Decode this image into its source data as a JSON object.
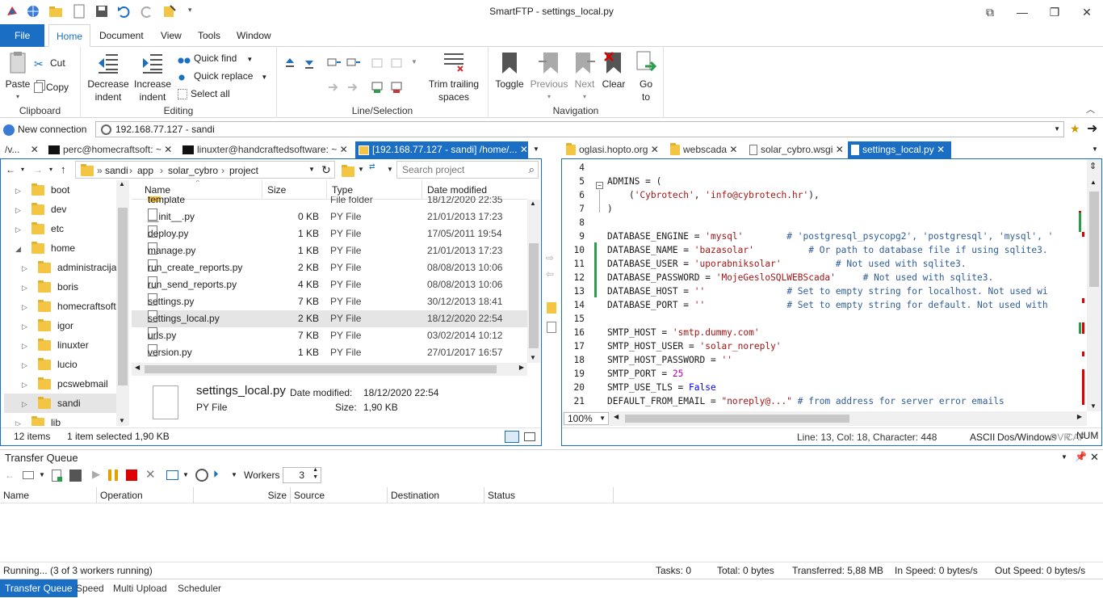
{
  "app": {
    "title": "SmartFTP - settings_local.py"
  },
  "ribbon_tabs": [
    "File",
    "Home",
    "Document",
    "View",
    "Tools",
    "Window"
  ],
  "ribbon": {
    "clipboard": {
      "label": "Clipboard",
      "paste": "Paste",
      "cut": "Cut",
      "copy": "Copy"
    },
    "editing": {
      "label": "Editing",
      "decrease_indent_1": "Decrease",
      "decrease_indent_2": "indent",
      "increase_indent_1": "Increase",
      "increase_indent_2": "indent",
      "quick_find": "Quick find",
      "quick_replace": "Quick replace",
      "select_all": "Select all"
    },
    "line_selection": {
      "label": "Line/Selection",
      "trim_1": "Trim trailing",
      "trim_2": "spaces"
    },
    "navigation": {
      "label": "Navigation",
      "toggle": "Toggle",
      "previous": "Previous",
      "next": "Next",
      "clear": "Clear",
      "goto_1": "Go",
      "goto_2": "to"
    }
  },
  "address": {
    "new_connection": "New connection",
    "value": "192.168.77.127 - sandi"
  },
  "left_tabs": [
    "/v...",
    "perc@homecraftsoft: ~",
    "linuxter@handcraftedsoftware: ~",
    "[192.168.77.127 - sandi] /home/..."
  ],
  "right_tabs": [
    "oglasi.hopto.org",
    "webscada",
    "solar_cybro.wsgi",
    "settings_local.py"
  ],
  "explorer": {
    "breadcrumb": [
      "sandi",
      "app",
      "solar_cybro",
      "project"
    ],
    "search_placeholder": "Search project",
    "tree": [
      "boot",
      "dev",
      "etc",
      "home",
      "administracija",
      "boris",
      "homecraftsoft",
      "igor",
      "linuxter",
      "lucio",
      "pcswebmail",
      "sandi",
      "lib"
    ],
    "columns": [
      "Name",
      "Size",
      "Type",
      "Date modified"
    ],
    "files": [
      {
        "name": "template",
        "size": "",
        "type": "File folder",
        "date": "18/12/2020 22:35"
      },
      {
        "name": "__init__.py",
        "size": "0 KB",
        "type": "PY File",
        "date": "21/01/2013 17:23"
      },
      {
        "name": "deploy.py",
        "size": "1 KB",
        "type": "PY File",
        "date": "17/05/2011 19:54"
      },
      {
        "name": "manage.py",
        "size": "1 KB",
        "type": "PY File",
        "date": "21/01/2013 17:23"
      },
      {
        "name": "run_create_reports.py",
        "size": "2 KB",
        "type": "PY File",
        "date": "08/08/2013 10:06"
      },
      {
        "name": "run_send_reports.py",
        "size": "4 KB",
        "type": "PY File",
        "date": "08/08/2013 10:06"
      },
      {
        "name": "settings.py",
        "size": "7 KB",
        "type": "PY File",
        "date": "30/12/2013 18:41"
      },
      {
        "name": "settings_local.py",
        "size": "2 KB",
        "type": "PY File",
        "date": "18/12/2020 22:54"
      },
      {
        "name": "urls.py",
        "size": "7 KB",
        "type": "PY File",
        "date": "03/02/2014 10:12"
      },
      {
        "name": "version.py",
        "size": "1 KB",
        "type": "PY File",
        "date": "27/01/2017 16:57"
      }
    ],
    "details": {
      "filename": "settings_local.py",
      "filetype": "PY File",
      "date_label": "Date modified:",
      "date_value": "18/12/2020 22:54",
      "size_label": "Size:",
      "size_value": "1,90 KB"
    },
    "status": {
      "items": "12 items",
      "selected": "1 item selected  1,90 KB"
    }
  },
  "editor": {
    "lines": [
      {
        "n": "4",
        "t": ""
      },
      {
        "n": "5",
        "t": "ADMINS = ("
      },
      {
        "n": "6",
        "t": "    ('Cybrotech', 'info@cybrotech.hr'),"
      },
      {
        "n": "7",
        "t": ")"
      },
      {
        "n": "8",
        "t": ""
      },
      {
        "n": "9",
        "t": "DATABASE_ENGINE = 'mysql'        # 'postgresql_psycopg2', 'postgresql', 'mysql', '"
      },
      {
        "n": "10",
        "t": "DATABASE_NAME = 'bazasolar'          # Or path to database file if using sqlite3."
      },
      {
        "n": "11",
        "t": "DATABASE_USER = 'uporabniksolar'          # Not used with sqlite3."
      },
      {
        "n": "12",
        "t": "DATABASE_PASSWORD = 'MojeGesloSQLWEBScada'     # Not used with sqlite3."
      },
      {
        "n": "13",
        "t": "DATABASE_HOST = ''               # Set to empty string for localhost. Not used wi"
      },
      {
        "n": "14",
        "t": "DATABASE_PORT = ''               # Set to empty string for default. Not used with"
      },
      {
        "n": "15",
        "t": ""
      },
      {
        "n": "16",
        "t": "SMTP_HOST = 'smtp.dummy.com'"
      },
      {
        "n": "17",
        "t": "SMTP_HOST_USER = 'solar_noreply'"
      },
      {
        "n": "18",
        "t": "SMTP_HOST_PASSWORD = ''"
      },
      {
        "n": "19",
        "t": "SMTP_PORT = 25"
      },
      {
        "n": "20",
        "t": "SMTP_USE_TLS = False"
      },
      {
        "n": "21",
        "t": "DEFAULT_FROM_EMAIL = \"noreply@...\" # from address for server error emails"
      }
    ],
    "zoom": "100%",
    "status": {
      "position": "Line: 13, Col: 18, Character: 448",
      "encoding": "ASCII",
      "eol": "Dos/Windows",
      "ovr": "OVR",
      "cap": "CAP",
      "num": "NUM"
    }
  },
  "transfer_queue": {
    "title": "Transfer Queue",
    "workers_label": "Workers",
    "workers_value": "3",
    "columns": [
      "Name",
      "Operation",
      "Size",
      "Source",
      "Destination",
      "Status"
    ],
    "status": {
      "running": "Running... (3 of 3 workers running)",
      "tasks": "Tasks: 0",
      "total": "Total: 0 bytes",
      "transferred": "Transferred: 5,88 MB",
      "in_speed": "In Speed: 0 bytes/s",
      "out_speed": "Out Speed: 0 bytes/s"
    }
  },
  "bottom_tabs": [
    "Transfer Queue",
    "Speed",
    "Multi Upload",
    "Scheduler"
  ],
  "colors": {
    "accent": "#1a6fc4"
  }
}
